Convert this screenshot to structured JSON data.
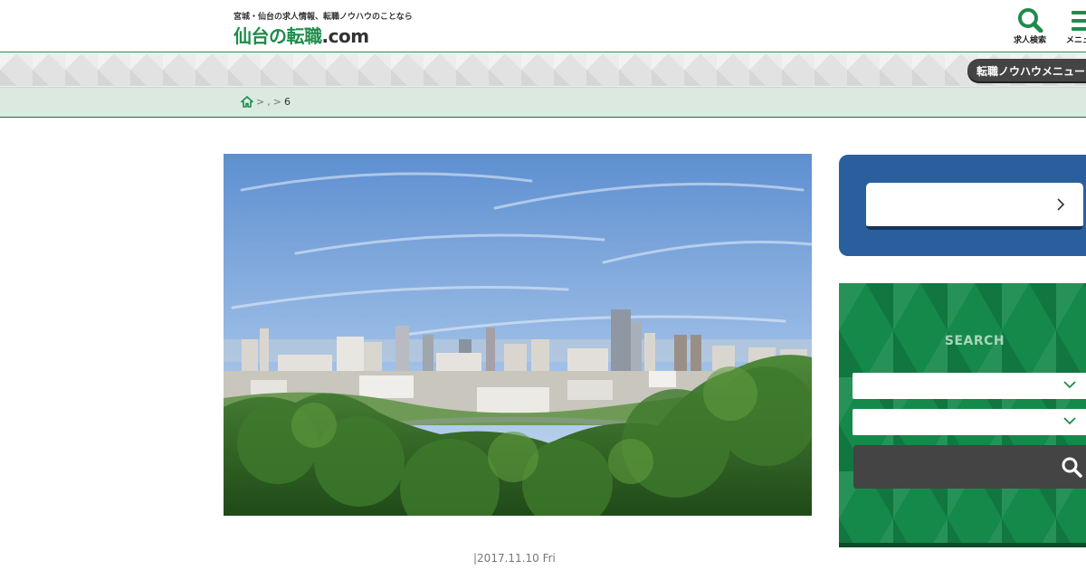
{
  "header": {
    "tagline": "宮城・仙台の求人情報、転職ノウハウのことなら",
    "logo_main": "仙台の転職",
    "logo_domain": ".com",
    "search_label": "求人検索",
    "menu_label": "メニュー"
  },
  "band": {
    "knowhow_menu_label": "転職ノウハウメニュー"
  },
  "breadcrumb": {
    "sep1": ">",
    "mid": ",",
    "sep2": ">",
    "current": "6"
  },
  "article": {
    "date": "|2017.11.10 Fri"
  },
  "sidebar": {
    "search_title": "SEARCH"
  },
  "icons": {
    "home": "home-icon",
    "search": "search-icon",
    "menu": "hamburger-menu-icon",
    "chevron_right": "chevron-right-icon",
    "chevron_down": "chevron-down-icon"
  },
  "colors": {
    "brand_green": "#1e8c4a",
    "sidebar_blue": "#2a5f9e",
    "sidebar_green": "#14894a",
    "dark_button": "#444444",
    "breadcrumb_bg": "#dbe9e1"
  }
}
